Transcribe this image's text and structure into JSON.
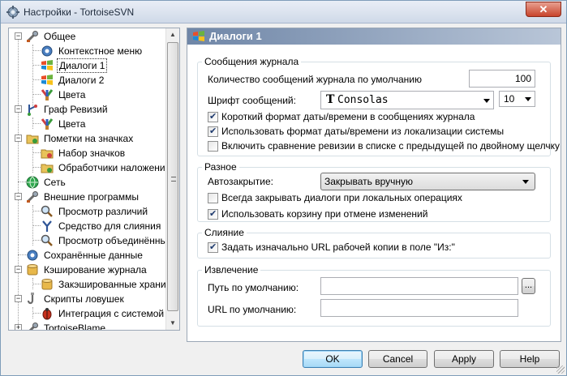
{
  "window": {
    "title": "Настройки - TortoiseSVN",
    "close_label": "✕"
  },
  "tree": {
    "items": [
      {
        "label": "Общее",
        "icon": "wrench-icon",
        "level": 0,
        "expanded": true
      },
      {
        "label": "Контекстное меню",
        "icon": "gear-icon",
        "level": 1
      },
      {
        "label": "Диалоги 1",
        "icon": "windows-flag-icon",
        "level": 1,
        "selected": true
      },
      {
        "label": "Диалоги 2",
        "icon": "windows-flag-icon",
        "level": 1
      },
      {
        "label": "Цвета",
        "icon": "paint-brush-icon",
        "level": 1
      },
      {
        "label": "Граф Ревизий",
        "icon": "revision-graph-icon",
        "level": 0,
        "expanded": true
      },
      {
        "label": "Цвета",
        "icon": "paint-brush-icon",
        "level": 1
      },
      {
        "label": "Пометки на значках",
        "icon": "folder-overlay-icon",
        "level": 0,
        "expanded": true
      },
      {
        "label": "Набор значков",
        "icon": "folder-overlay-icon",
        "level": 1
      },
      {
        "label": "Обработчики наложени",
        "icon": "folder-overlay-icon",
        "level": 1
      },
      {
        "label": "Сеть",
        "icon": "globe-icon",
        "level": 0
      },
      {
        "label": "Внешние программы",
        "icon": "wrench-icon",
        "level": 0,
        "expanded": true
      },
      {
        "label": "Просмотр различий",
        "icon": "magnifier-icon",
        "level": 1
      },
      {
        "label": "Средство для слияния",
        "icon": "merge-icon",
        "level": 1
      },
      {
        "label": "Просмотр объединённь",
        "icon": "magnifier-icon",
        "level": 1
      },
      {
        "label": "Сохранённые данные",
        "icon": "gear-icon",
        "level": 0
      },
      {
        "label": "Кэширование журнала",
        "icon": "database-icon",
        "level": 0,
        "expanded": true
      },
      {
        "label": "Закэшированные храни",
        "icon": "database-icon",
        "level": 1
      },
      {
        "label": "Скрипты ловушек",
        "icon": "hook-icon",
        "level": 0,
        "expanded": true
      },
      {
        "label": "Интеграция с системой",
        "icon": "bug-icon",
        "level": 1
      },
      {
        "label": "TortoiseBlame",
        "icon": "wrench-icon",
        "level": 0
      }
    ]
  },
  "page": {
    "title": "Диалоги 1",
    "log_messages": {
      "group_title": "Сообщения журнала",
      "count_label": "Количество сообщений журнала по умолчанию",
      "count_value": "100",
      "font_label": "Шрифт сообщений:",
      "font_value": "Consolas",
      "font_icon_glyph": "T",
      "font_size_value": "10",
      "short_date_label": "Короткий формат даты/времени в сообщениях журнала",
      "short_date_checked": true,
      "locale_date_label": "Использовать формат даты/времени из локализации системы",
      "locale_date_checked": true,
      "double_click_label": "Включить сравнение ревизии в списке с предыдущей по двойному щелчку",
      "double_click_checked": false
    },
    "misc": {
      "group_title": "Разное",
      "autoclose_label": "Автозакрытие:",
      "autoclose_value": "Закрывать вручную",
      "always_close_label": "Всегда закрывать диалоги при локальных операциях",
      "always_close_checked": false,
      "recycle_bin_label": "Использовать корзину при отмене изменений",
      "recycle_bin_checked": true
    },
    "merge": {
      "group_title": "Слияние",
      "prefill_url_label": "Задать изначально URL рабочей копии в поле \"Из:\"",
      "prefill_url_checked": true
    },
    "checkout": {
      "group_title": "Извлечение",
      "default_path_label": "Путь по умолчанию:",
      "default_path_value": "",
      "browse_label": "...",
      "default_url_label": "URL по умолчанию:",
      "default_url_value": ""
    }
  },
  "buttons": {
    "ok": "OK",
    "cancel": "Cancel",
    "apply": "Apply",
    "help": "Help"
  },
  "colors": {
    "header_gradient_start": "#6f86a7",
    "header_gradient_end": "#b9c6d8",
    "default_button_border": "#3c7fb1"
  }
}
